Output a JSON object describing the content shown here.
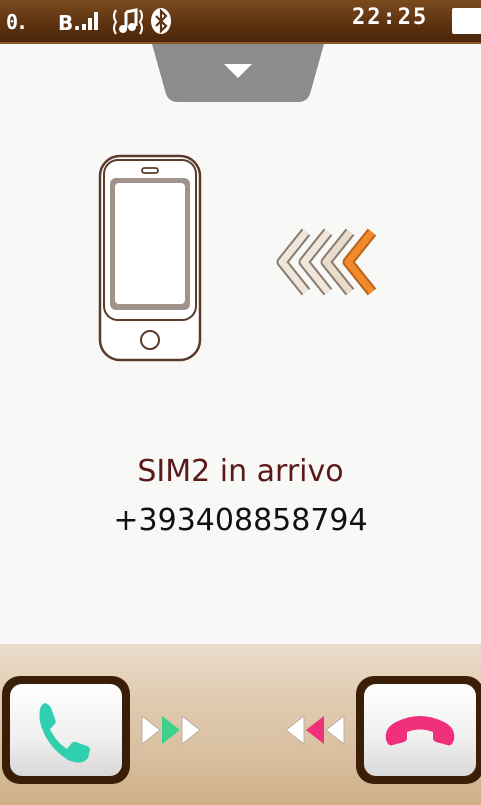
{
  "status_bar": {
    "sim1_indicator": "0.",
    "sim2_indicator": "B.ıl",
    "music_icon": "music-note-icon",
    "bluetooth_icon": "bluetooth-icon",
    "time": "22:25",
    "battery_icon": "battery-icon"
  },
  "call": {
    "label": "SIM2 in arrivo",
    "number": "+393408858794"
  },
  "actions": {
    "accept_icon": "phone-answer-icon",
    "reject_icon": "phone-hangup-icon"
  },
  "colors": {
    "statusbar": "#5c3210",
    "caller_label": "#5a1a1a",
    "accept": "#2fcfb0",
    "reject": "#f0307a",
    "incoming_arrow": "#f08a2a"
  }
}
